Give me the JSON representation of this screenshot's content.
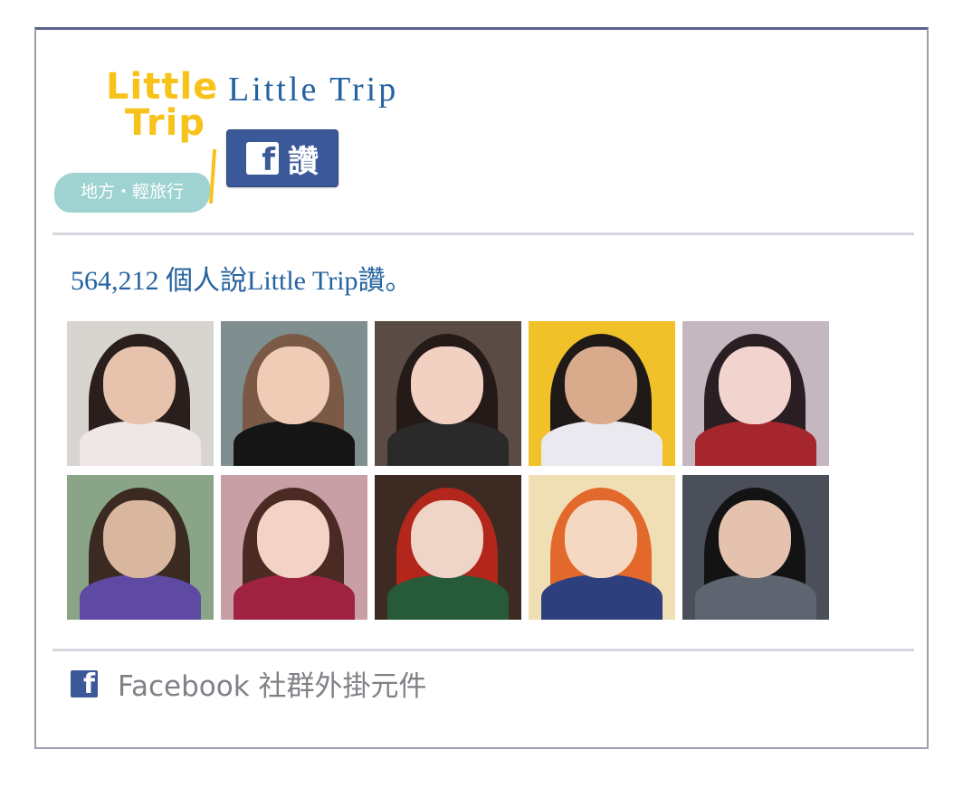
{
  "logo": {
    "line1": "Little",
    "line2": "Trip",
    "badge": "地方‧輕旅行"
  },
  "page_name": "Little Trip",
  "like_button": {
    "icon": "facebook-icon",
    "label": "讚"
  },
  "like_count_text": "564,212 個人說Little Trip讚。",
  "fans": [
    {
      "bg": "#d8d4d0",
      "hair": "#2a1f1c",
      "skin": "#e7c2ac",
      "body": "#efe6e6"
    },
    {
      "bg": "#7f8e8f",
      "hair": "#7a5a45",
      "skin": "#f0cbb5",
      "body": "#151515"
    },
    {
      "bg": "#5a4c45",
      "hair": "#241a17",
      "skin": "#f2d1c2",
      "body": "#2a2a2a"
    },
    {
      "bg": "#f1c12a",
      "hair": "#1f1a18",
      "skin": "#d9ab8c",
      "body": "#e9e9ef"
    },
    {
      "bg": "#c5b7bf",
      "hair": "#2a1e22",
      "skin": "#f2d4cf",
      "body": "#a5262c"
    },
    {
      "bg": "#8aa488",
      "hair": "#3a2a22",
      "skin": "#d9b79f",
      "body": "#5e4aa3"
    },
    {
      "bg": "#c99fa6",
      "hair": "#4a2a22",
      "skin": "#f3d3c6",
      "body": "#9f2341"
    },
    {
      "bg": "#3d2a22",
      "hair": "#b2261c",
      "skin": "#efd4c8",
      "body": "#265a39"
    },
    {
      "bg": "#f0dfb5",
      "hair": "#e2692b",
      "skin": "#f4d8c2",
      "body": "#2d3f7d"
    },
    {
      "bg": "#4b4f5a",
      "hair": "#131313",
      "skin": "#e4c2ad",
      "body": "#5f6471"
    }
  ],
  "footer": {
    "icon": "facebook-icon",
    "text": "Facebook 社群外掛元件"
  },
  "colors": {
    "facebook_blue": "#3b5998",
    "title_blue": "#2463a0",
    "logo_yellow": "#f7c21a",
    "badge_teal": "#9ed3d1"
  }
}
